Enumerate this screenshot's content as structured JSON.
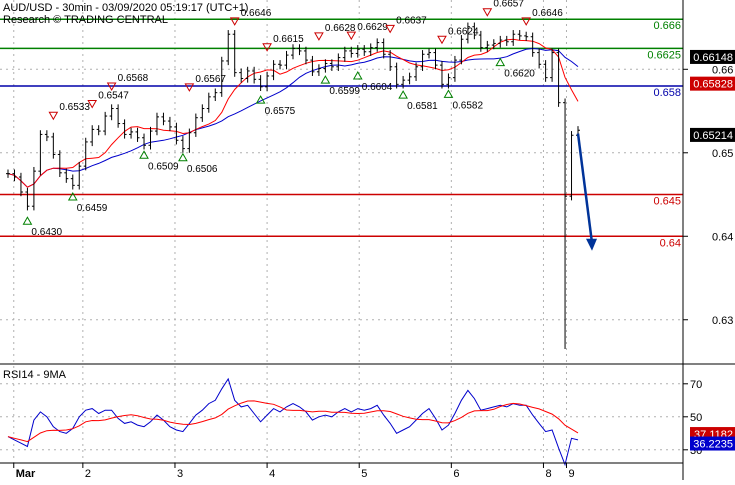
{
  "header": {
    "title": "AUD/USD - 30min - 03/09/2020 05:19:17 (UTC+1)",
    "subtitle": "Research © TRADING CENTRAL"
  },
  "rsi_panel": {
    "label": "RSI14 - 9MA"
  },
  "colors": {
    "price": "#000000",
    "ma_red": "#ff0000",
    "ma_blue": "#0000cc",
    "resistance": "#008000",
    "pivot": "#0000aa",
    "support": "#cc0000",
    "arrow": "#003399",
    "grid": "#b0b0b0",
    "rsi_line": "#0000cc",
    "rsi_ma": "#ff0000"
  },
  "chart_data": [
    {
      "type": "line",
      "title": "AUD/USD - 30min - 03/09/2020 05:19:17 (UTC+1)",
      "ylim": [
        0.6247,
        0.6683
      ],
      "yticks": [
        0.63,
        0.64,
        0.65,
        0.66
      ],
      "ytick_labels": [
        "0.63",
        "0.64",
        "0.65",
        "0.66"
      ],
      "xticks": [
        "Mar",
        "2",
        "3",
        "4",
        "5",
        "6",
        "8",
        "9"
      ],
      "series": [
        {
          "values": [
            0.6475,
            0.6471,
            0.6453,
            0.6436,
            0.6478,
            0.6522,
            0.6519,
            0.6498,
            0.6476,
            0.6469,
            0.6461,
            0.6484,
            0.6513,
            0.6528,
            0.6526,
            0.6544,
            0.6553,
            0.6535,
            0.6522,
            0.6525,
            0.6518,
            0.6509,
            0.6526,
            0.6543,
            0.6538,
            0.6531,
            0.6515,
            0.6505,
            0.6524,
            0.6542,
            0.6553,
            0.6567,
            0.6572,
            0.661,
            0.6642,
            0.6596,
            0.6589,
            0.6598,
            0.6588,
            0.6579,
            0.6592,
            0.6606,
            0.6605,
            0.6617,
            0.6625,
            0.6622,
            0.6611,
            0.6597,
            0.6601,
            0.6607,
            0.6603,
            0.6614,
            0.6622,
            0.6619,
            0.6624,
            0.6621,
            0.6626,
            0.6632,
            0.6618,
            0.6603,
            0.6582,
            0.6587,
            0.6591,
            0.6603,
            0.6618,
            0.662,
            0.6605,
            0.6582,
            0.659,
            0.6611,
            0.6636,
            0.6651,
            0.6641,
            0.6626,
            0.6629,
            0.6631,
            0.6635,
            0.6633,
            0.6642,
            0.664,
            0.6639,
            0.662,
            0.6606,
            0.659,
            0.662,
            0.656,
            0.6448,
            0.6521,
            0.6527
          ]
        },
        {
          "name": "RSI14",
          "values": [
            38,
            36,
            34,
            32,
            48,
            53,
            50,
            44,
            41,
            40,
            43,
            50,
            54,
            55,
            52,
            54,
            54,
            49,
            46,
            47,
            45,
            44,
            47,
            51,
            48,
            44,
            42,
            41,
            46,
            51,
            54,
            58,
            60,
            67,
            73,
            60,
            56,
            57,
            52,
            47,
            51,
            55,
            53,
            56,
            58,
            56,
            53,
            48,
            50,
            51,
            50,
            53,
            55,
            53,
            55,
            54,
            55,
            57,
            51,
            46,
            40,
            42,
            44,
            48,
            52,
            55,
            49,
            42,
            45,
            52,
            60,
            66,
            61,
            54,
            55,
            56,
            57,
            56,
            58,
            57,
            57,
            51,
            46,
            41,
            42,
            31,
            21,
            37,
            36
          ]
        }
      ],
      "levels": [
        {
          "label": "0.666",
          "value": 0.666,
          "role": "resistance"
        },
        {
          "label": "0.6625",
          "value": 0.6625,
          "role": "resistance"
        },
        {
          "label": "0.658",
          "value": 0.658,
          "role": "pivot"
        },
        {
          "label": "0.645",
          "value": 0.645,
          "role": "support"
        },
        {
          "label": "0.64",
          "value": 0.64,
          "role": "support"
        }
      ],
      "last_values": [
        {
          "label": "0.66148",
          "value": 0.66148,
          "color": "#000000"
        },
        {
          "label": "0.65828",
          "value": 0.65828,
          "color": "#cc0000"
        },
        {
          "label": "0.65214",
          "value": 0.65214,
          "color": "#000000"
        }
      ],
      "annotations": [
        {
          "text": "0.6430",
          "x": 3,
          "value": 0.643,
          "kind": "low"
        },
        {
          "text": "0.6533",
          "x": 7,
          "value": 0.6533,
          "kind": "high"
        },
        {
          "text": "0.6459",
          "x": 10,
          "value": 0.6459,
          "kind": "low"
        },
        {
          "text": "0.6547",
          "x": 13,
          "value": 0.6547,
          "kind": "high"
        },
        {
          "text": "0.6568",
          "x": 16,
          "value": 0.6568,
          "kind": "high"
        },
        {
          "text": "0.6509",
          "x": 21,
          "value": 0.6509,
          "kind": "low"
        },
        {
          "text": "0.6506",
          "x": 27,
          "value": 0.6506,
          "kind": "low"
        },
        {
          "text": "0.6567",
          "x": 28,
          "value": 0.6567,
          "kind": "high"
        },
        {
          "text": "0.6646",
          "x": 35,
          "value": 0.6646,
          "kind": "high"
        },
        {
          "text": "0.6575",
          "x": 39,
          "value": 0.6575,
          "kind": "low"
        },
        {
          "text": "0.6615",
          "x": 40,
          "value": 0.6615,
          "kind": "high"
        },
        {
          "text": "0.6628",
          "x": 48,
          "value": 0.6628,
          "kind": "high"
        },
        {
          "text": "0.6599",
          "x": 49,
          "value": 0.6599,
          "kind": "low"
        },
        {
          "text": "0.6629",
          "x": 53,
          "value": 0.6629,
          "kind": "high"
        },
        {
          "text": "0.6604",
          "x": 54,
          "value": 0.6604,
          "kind": "low"
        },
        {
          "text": "0.6637",
          "x": 59,
          "value": 0.6637,
          "kind": "high"
        },
        {
          "text": "0.6581",
          "x": 61,
          "value": 0.6581,
          "kind": "low"
        },
        {
          "text": "0.6624",
          "x": 67,
          "value": 0.6624,
          "kind": "high"
        },
        {
          "text": "0.6582",
          "x": 68,
          "value": 0.6582,
          "kind": "low"
        },
        {
          "text": "0.6657",
          "x": 74,
          "value": 0.6657,
          "kind": "high"
        },
        {
          "text": "0.6620",
          "x": 76,
          "value": 0.662,
          "kind": "low"
        },
        {
          "text": "0.6646",
          "x": 80,
          "value": 0.6646,
          "kind": "high"
        }
      ],
      "forecast_arrow": {
        "from": 0.6523,
        "to": 0.6385
      }
    },
    {
      "type": "line",
      "title": "RSI14 - 9MA",
      "ylim": [
        22,
        82
      ],
      "yticks": [
        30,
        50,
        70
      ],
      "ytick_labels": [
        "30",
        "50",
        "70"
      ],
      "last_values": [
        {
          "label": "37.1182",
          "value": 37.1182,
          "color": "#cc0000"
        },
        {
          "label": "36.2235",
          "value": 36.2235,
          "color": "#0000cc"
        }
      ]
    }
  ]
}
